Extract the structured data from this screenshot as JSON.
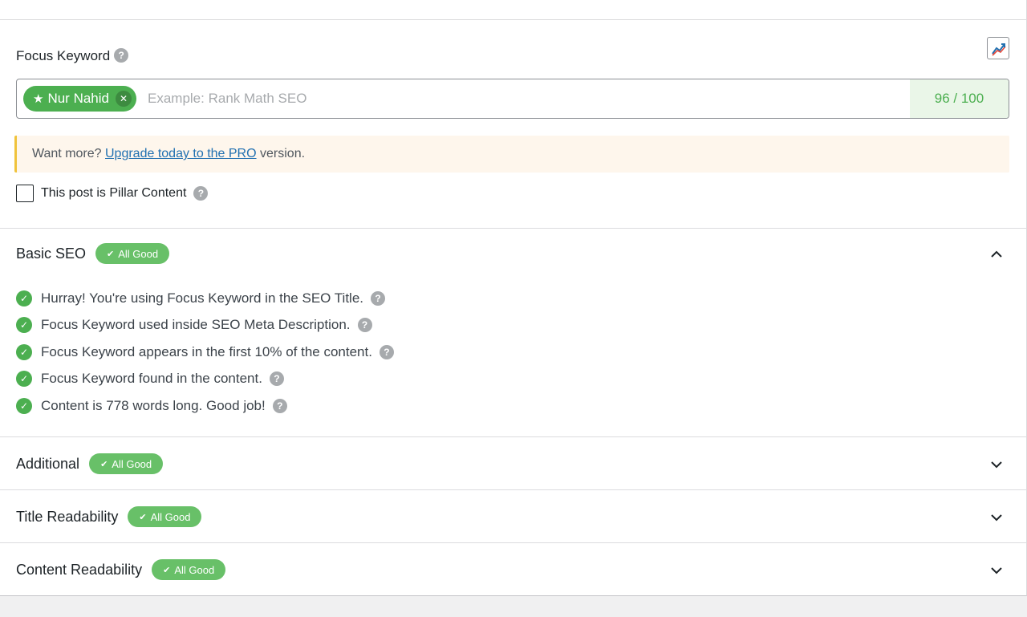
{
  "focus_keyword": {
    "label": "Focus Keyword",
    "help": "?",
    "keyword_tag": "Nur Nahid",
    "input_placeholder": "Example: Rank Math SEO",
    "score": "96 / 100",
    "trend_icon": "trend-chart-icon"
  },
  "notice": {
    "prefix": "Want more?",
    "link": "Upgrade today to the PRO",
    "suffix": "version."
  },
  "pillar": {
    "label": "This post is Pillar Content",
    "checked": false
  },
  "sections": {
    "basic_seo": {
      "title": "Basic SEO",
      "badge": "All Good",
      "expanded": true,
      "checks": [
        "Hurray! You're using Focus Keyword in the SEO Title.",
        "Focus Keyword used inside SEO Meta Description.",
        "Focus Keyword appears in the first 10% of the content.",
        "Focus Keyword found in the content.",
        "Content is 778 words long. Good job!"
      ]
    },
    "additional": {
      "title": "Additional",
      "badge": "All Good",
      "expanded": false
    },
    "title_readability": {
      "title": "Title Readability",
      "badge": "All Good",
      "expanded": false
    },
    "content_readability": {
      "title": "Content Readability",
      "badge": "All Good",
      "expanded": false
    }
  },
  "colors": {
    "good_green": "#4caf50",
    "badge_green": "#68c068",
    "score_bg": "#eaf6e8",
    "notice_bg": "#fef6ec",
    "notice_border": "#f0c33c",
    "link": "#2271b1"
  }
}
